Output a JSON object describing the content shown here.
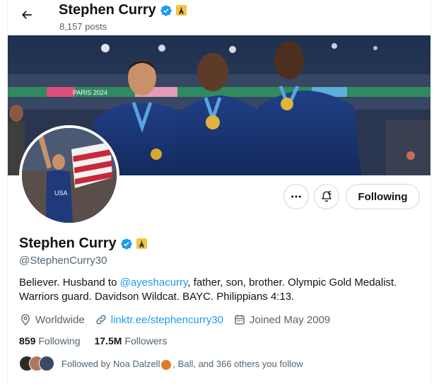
{
  "header": {
    "name": "Stephen Curry",
    "posts": "8,157 posts"
  },
  "profile": {
    "name": "Stephen Curry",
    "handle": "@StephenCurry30",
    "bio_before": "Believer. Husband to ",
    "bio_mention": "@ayeshacurry",
    "bio_after": ", father, son, brother. Olympic Gold Medalist. Warriors guard. Davidson Wildcat. BAYC. Philippians 4:13.",
    "location": "Worldwide",
    "link": "linktr.ee/stephencurry30",
    "joined": "Joined May 2009"
  },
  "actions": {
    "following_label": "Following"
  },
  "stats": {
    "following_count": "859",
    "following_label": "Following",
    "followers_count": "17.5M",
    "followers_label": "Followers"
  },
  "followed_by": {
    "text_before": "Followed by Noa Dalzell",
    "text_after": ", Ball, and 366 others you follow"
  },
  "banner": {
    "signage": "PARIS 2024"
  },
  "colors": {
    "accent": "#1d9bf0",
    "secondary_text": "#536471",
    "border": "#cfd9de",
    "verified": "#1d9bf0",
    "affiliate_badge": "#f4c542"
  },
  "icons": [
    "back-arrow-icon",
    "verified-badge-icon",
    "affiliate-badge-icon",
    "more-icon",
    "notification-bell-icon",
    "location-icon",
    "link-icon",
    "calendar-icon"
  ]
}
